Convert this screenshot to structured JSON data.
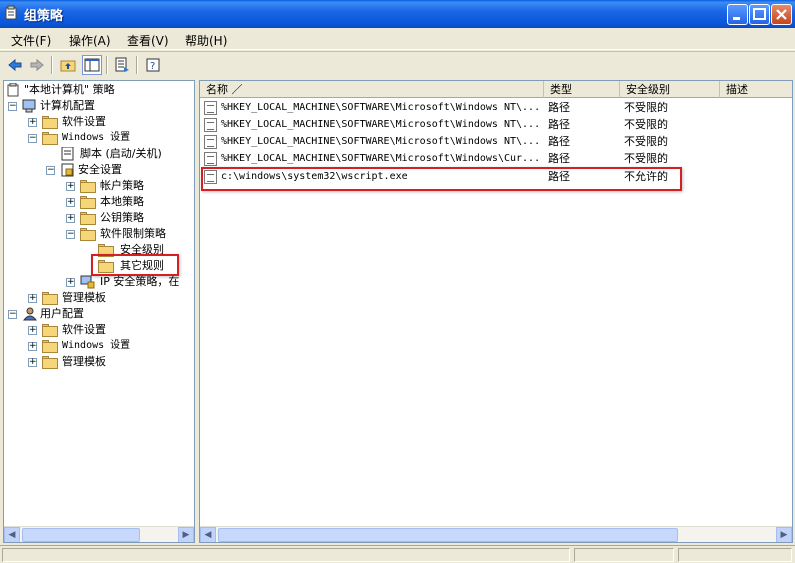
{
  "window": {
    "title": "组策略"
  },
  "menu": [
    {
      "label": "文件(F)"
    },
    {
      "label": "操作(A)"
    },
    {
      "label": "查看(V)"
    },
    {
      "label": "帮助(H)"
    }
  ],
  "toolbar": {
    "tools": [
      "back-arrow-icon",
      "forward-arrow-icon",
      "up-folder-icon",
      "show-tree-icon",
      "export-list-icon",
      "help-icon"
    ]
  },
  "tree": {
    "root": "\"本地计算机\" 策略",
    "computer_config": "计算机配置",
    "software_settings": "软件设置",
    "windows_settings": "Windows 设置",
    "scripts": "脚本 (启动/关机)",
    "security_settings": "安全设置",
    "account_policies": "帐户策略",
    "local_policies": "本地策略",
    "public_key_policies": "公钥策略",
    "software_restriction": "软件限制策略",
    "security_levels": "安全级别",
    "additional_rules": "其它规则",
    "ip_security": "IP 安全策略，在",
    "admin_templates": "管理模板",
    "user_config": "用户配置",
    "user_software_settings": "软件设置",
    "user_windows_settings": "Windows 设置",
    "user_admin_templates": "管理模板"
  },
  "list": {
    "columns": [
      "名称 ／",
      "类型",
      "安全级别",
      "描述"
    ],
    "rows": [
      {
        "name": "%HKEY_LOCAL_MACHINE\\SOFTWARE\\Microsoft\\Windows NT\\...",
        "type": "路径",
        "level": "不受限的",
        "desc": ""
      },
      {
        "name": "%HKEY_LOCAL_MACHINE\\SOFTWARE\\Microsoft\\Windows NT\\...",
        "type": "路径",
        "level": "不受限的",
        "desc": ""
      },
      {
        "name": "%HKEY_LOCAL_MACHINE\\SOFTWARE\\Microsoft\\Windows NT\\...",
        "type": "路径",
        "level": "不受限的",
        "desc": ""
      },
      {
        "name": "%HKEY_LOCAL_MACHINE\\SOFTWARE\\Microsoft\\Windows\\Cur...",
        "type": "路径",
        "level": "不受限的",
        "desc": ""
      },
      {
        "name": "c:\\windows\\system32\\wscript.exe",
        "type": "路径",
        "level": "不允许的",
        "desc": ""
      }
    ]
  },
  "colors": {
    "highlight": "#d42020",
    "titlebar": "#0a55d8"
  }
}
